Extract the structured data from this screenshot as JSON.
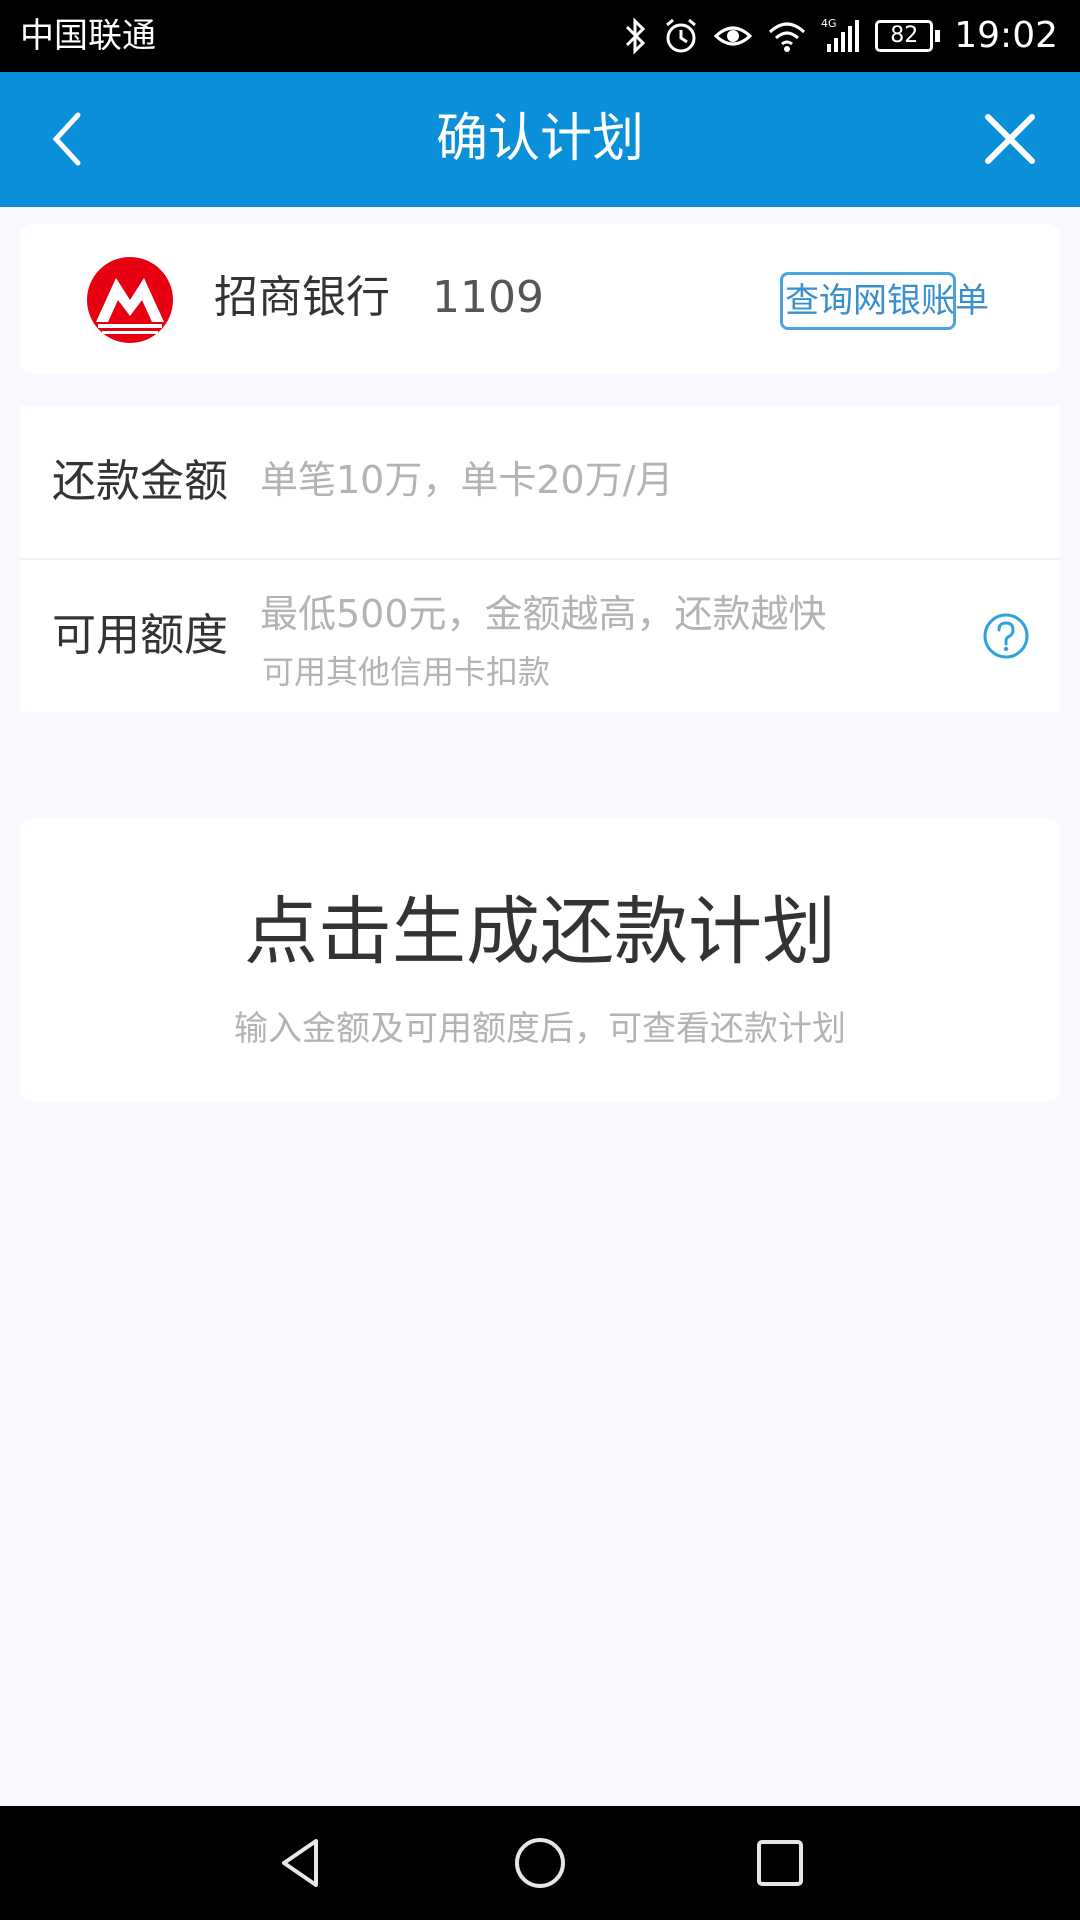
{
  "status_bar": {
    "carrier": "中国联通",
    "network": "4G",
    "battery": "82",
    "time": "19:02",
    "icons": [
      "bluetooth-icon",
      "alarm-icon",
      "eye-icon",
      "wifi-icon",
      "signal-icon",
      "battery-icon"
    ]
  },
  "header": {
    "title": "确认计划",
    "back_icon": "chevron-left-icon",
    "close_icon": "close-icon",
    "background_color": "#0a8fd8"
  },
  "bank": {
    "logo": "cmb-logo",
    "logo_color": "#e60012",
    "name": "招商银行",
    "card_tail": "1109",
    "query_button": "查询网银账单"
  },
  "form": {
    "amount_label": "还款金额",
    "amount_placeholder": "单笔10万，单卡20万/月",
    "credit_label": "可用额度",
    "credit_placeholder": "最低500元，金额越高，还款越快",
    "credit_hint": "可用其他信用卡扣款",
    "help_icon": "question-circle-icon"
  },
  "plan": {
    "title": "点击生成还款计划",
    "subtitle": "输入金额及可用额度后，可查看还款计划"
  },
  "nav_bar": {
    "icons": [
      "nav-back-icon",
      "nav-home-icon",
      "nav-recents-icon"
    ]
  }
}
